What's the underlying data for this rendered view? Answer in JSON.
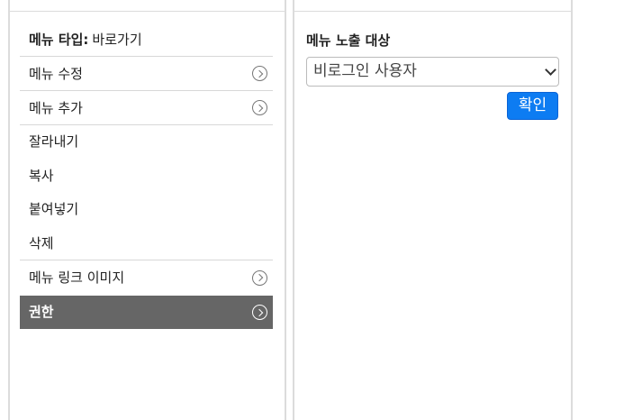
{
  "menu_panel": {
    "type_row": {
      "label": "메뉴 타입:",
      "value": "바로가기"
    },
    "items": [
      {
        "label": "메뉴 수정",
        "has_chevron": true
      },
      {
        "label": "메뉴 추가",
        "has_chevron": true
      },
      {
        "label": "잘라내기",
        "has_chevron": false
      },
      {
        "label": "복사",
        "has_chevron": false
      },
      {
        "label": "붙여넣기",
        "has_chevron": false
      },
      {
        "label": "삭제",
        "has_chevron": false
      },
      {
        "label": "메뉴 링크 이미지",
        "has_chevron": true
      },
      {
        "label": "권한",
        "has_chevron": true,
        "active": true
      }
    ],
    "active_bg_color": "#666666"
  },
  "permission_panel": {
    "field_label": "메뉴 노출 대상",
    "select": {
      "selected": "비로그인 사용자"
    },
    "confirm_label": "확인",
    "confirm_color": "#0d7cf2"
  },
  "icons": {
    "chevron": "chevron-right-circle-icon",
    "select_arrow": "chevron-down-icon"
  }
}
